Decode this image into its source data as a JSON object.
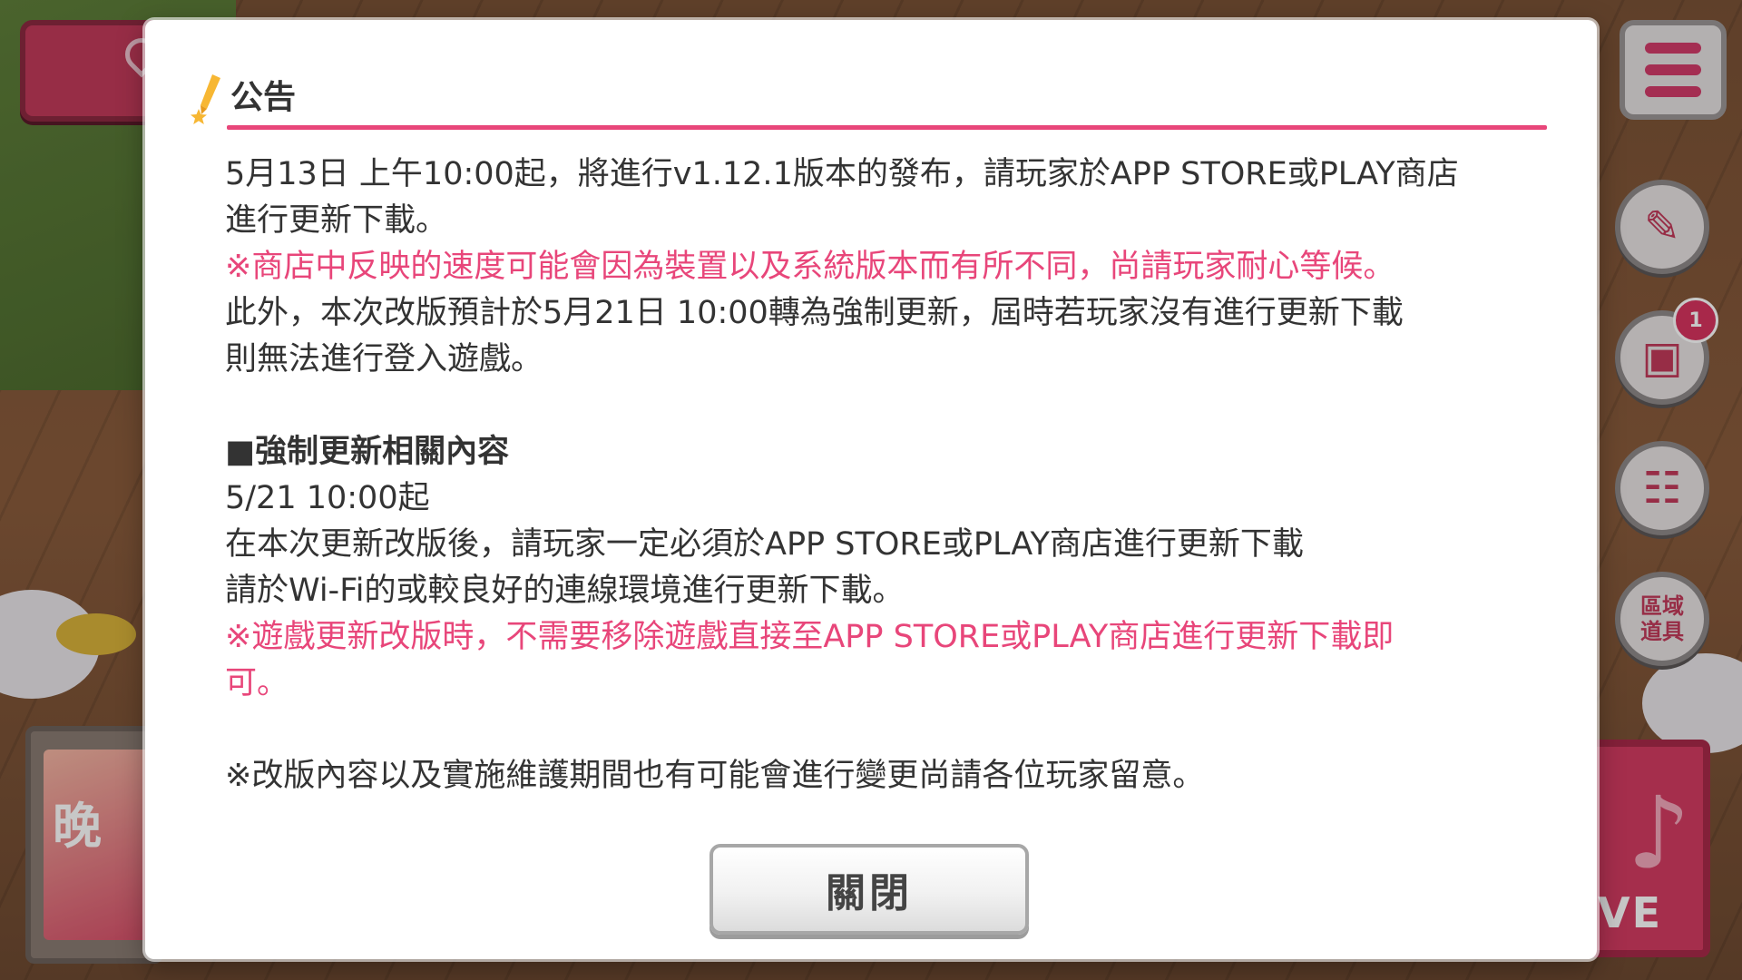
{
  "modal": {
    "title": "公告",
    "lines": {
      "l1": "5月13日 上午10:00起，將進行v1.12.1版本的發布，請玩家於APP STORE或PLAY商店",
      "l2": "進行更新下載。",
      "l3": "※商店中反映的速度可能會因為裝置以及系統版本而有所不同，尚請玩家耐心等候。",
      "l4": "此外，本次改版預計於5月21日 10:00轉為強制更新，屆時若玩家沒有進行更新下載",
      "l5": "則無法進行登入遊戲。",
      "l6": "■強制更新相關內容",
      "l7": "5/21 10:00起",
      "l8": "在本次更新改版後，請玩家一定必須於APP STORE或PLAY商店進行更新下載",
      "l9": "請於Wi-Fi的或較良好的連線環境進行更新下載。",
      "l10": "※遊戲更新改版時，不需要移除遊戲直接至APP STORE或PLAY商店進行更新下載即",
      "l11": "可。",
      "l12": "※改版內容以及實施維護期間也有可能會進行變更尚請各位玩家留意。"
    },
    "close_label": "關閉"
  },
  "side": {
    "gift_badge_count": "1",
    "area_items_label_1": "區域",
    "area_items_label_2": "道具",
    "live_label": "VE",
    "banner_text": "晚"
  },
  "colors": {
    "accent": "#e8467a",
    "text": "#333333"
  },
  "icons": {
    "title": "pencil-star-icon",
    "menu": "hamburger-menu-icon",
    "map": "map-pin-icon",
    "pen": "pen-icon",
    "gift": "gift-icon",
    "list": "checklist-icon",
    "live": "music-note-icon"
  }
}
